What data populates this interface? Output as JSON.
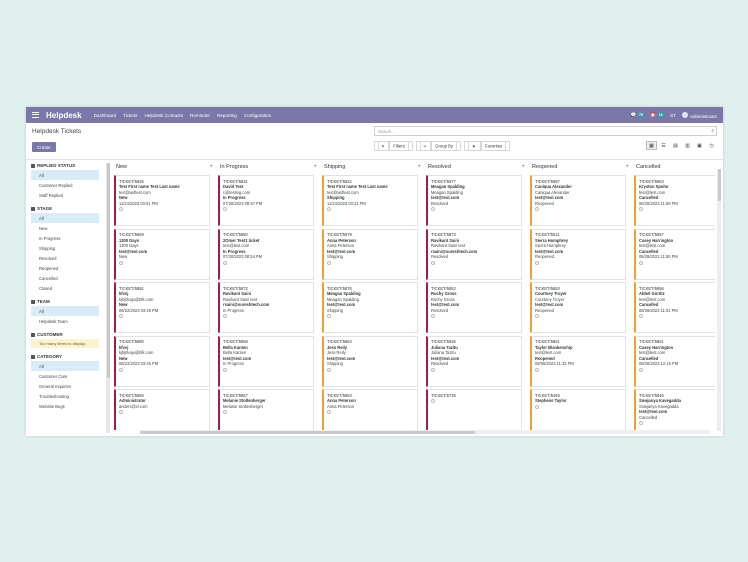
{
  "app": {
    "brand": "Helpdesk",
    "menu": [
      "Dashboard",
      "Tickets",
      "Helpdesk Contacts",
      "Reminder",
      "Reporting",
      "Configuration"
    ],
    "badge1": "79",
    "badge2": "19",
    "user_initials": "ST",
    "user_name": "Administrator"
  },
  "control": {
    "title": "Helpdesk Tickets",
    "create_label": "Create",
    "search_placeholder": "Search...",
    "filters_label": "Filters",
    "group_by_label": "Group By",
    "favorites_label": "Favorites"
  },
  "sidebar": {
    "replied": {
      "title": "REPLIED STATUS",
      "items": [
        "All",
        "Customer Replied",
        "Staff Replied"
      ]
    },
    "stage": {
      "title": "STAGE",
      "items": [
        "All",
        "New",
        "In Progress",
        "Shipping",
        "Resolved",
        "Reopened",
        "Cancelled",
        "Closed"
      ]
    },
    "team": {
      "title": "TEAM",
      "items": [
        "All",
        "Helpdesk Team"
      ]
    },
    "customer": {
      "title": "CUSTOMER",
      "note": "Too many items to display."
    },
    "category": {
      "title": "CATEGORY",
      "items": [
        "All",
        "Customer Care",
        "General Inquiries",
        "Troubleshooting",
        "Website Bugs"
      ]
    }
  },
  "columns": [
    {
      "name": "New",
      "color": "#a4194f",
      "cards": [
        {
          "id": "TICKET/5825",
          "name": "Test First name Test Last name",
          "email": "test@asftest.com",
          "stage": "New",
          "date": "11/24/2023 03:01 PM"
        },
        {
          "id": "TICKET/5869",
          "name": "1300 Days",
          "email": "1300 Days",
          "stage": "test@test.com",
          "date": "New"
        },
        {
          "id": "TICKET/5891",
          "name": "kfvvj",
          "email": "kjhjlrkaju@bfk.com",
          "stage": "New",
          "date": "08/22/2023 03:45 PM"
        },
        {
          "id": "TICKET/5890",
          "name": "kfvvj",
          "email": "kjhjlrkaju@bfk.com",
          "stage": "New",
          "date": "08/22/2023 03:45 PM"
        },
        {
          "id": "TICKET/5886",
          "name": "Administrator",
          "email": "anders@sl.com",
          "stage": "",
          "date": ""
        }
      ]
    },
    {
      "name": "In Progress",
      "color": "#a4194f",
      "cards": [
        {
          "id": "TICKET/5831",
          "name": "David Test",
          "email": "c@testing.com",
          "stage": "In Progress",
          "date": "07/28/2023 08:57 PM"
        },
        {
          "id": "TICKET/5880",
          "name": "2Omer Test1 ticket",
          "email": "test@test.com",
          "stage": "In Progress",
          "date": "07/20/2023 08:54 PM"
        },
        {
          "id": "TICKET/5872",
          "name": "Ravikant Saini",
          "email": "Ravikant Saini test",
          "stage": "rsaini@sureshtech.com",
          "date": "In Progress"
        },
        {
          "id": "TICKET/5868",
          "name": "Bella Kanten",
          "email": "Bella Kanten",
          "stage": "test@test.com",
          "date": "In Progress"
        },
        {
          "id": "TICKET/5867",
          "name": "Melanie Stoltenberger",
          "email": "Melanie Stoltenberger",
          "stage": "",
          "date": ""
        }
      ]
    },
    {
      "name": "Shipping",
      "color": "#f0a030",
      "cards": [
        {
          "id": "TICKET/5822",
          "name": "Test First name Test Last name",
          "email": "test@asftest.com",
          "stage": "Shipping",
          "date": "11/24/2023 03:22 PM"
        },
        {
          "id": "TICKET/5879",
          "name": "Anna Peterson",
          "email": "Anna Peterson",
          "stage": "test@test.com",
          "date": "Shipping"
        },
        {
          "id": "TICKET/5876",
          "name": "Meagan Spalding",
          "email": "Meagan Spalding",
          "stage": "test@test.com",
          "date": "Shipping"
        },
        {
          "id": "TICKET/5864",
          "name": "Jess Reily",
          "email": "Jess Reily",
          "stage": "test@test.com",
          "date": "Shipping"
        },
        {
          "id": "TICKET/5863",
          "name": "Anna Peterson",
          "email": "Anna Peterson",
          "stage": "",
          "date": ""
        }
      ]
    },
    {
      "name": "Resolved",
      "color": "#a4194f",
      "cards": [
        {
          "id": "TICKET/5877",
          "name": "Meagan Spalding",
          "email": "Meagan Spalding",
          "stage": "test@test.com",
          "date": "Resolved"
        },
        {
          "id": "TICKET/5873",
          "name": "Ravikant Saini",
          "email": "Ravikant Saini test",
          "stage": "rsaini@sureshtech.com",
          "date": "Resolved"
        },
        {
          "id": "TICKET/5852",
          "name": "Ruchy Gross",
          "email": "Ruchy Gross",
          "stage": "test@test.com",
          "date": "Resolved"
        },
        {
          "id": "TICKET/5836",
          "name": "Juliana Tazitu",
          "email": "Juliana Tazitu",
          "stage": "test@test.com",
          "date": "Resolved"
        },
        {
          "id": "TICKET/5735",
          "name": "",
          "email": "",
          "stage": "",
          "date": ""
        }
      ]
    },
    {
      "name": "Reopened",
      "color": "#f0a030",
      "cards": [
        {
          "id": "TICKET/5887",
          "name": "Caniqua Alexander",
          "email": "Caniqua Alexander",
          "stage": "test@test.com",
          "date": "Reopened"
        },
        {
          "id": "TICKET/5611",
          "name": "Sierra Humphrey",
          "email": "Sierra Humphrey",
          "stage": "test@test.com",
          "date": "Reopened"
        },
        {
          "id": "TICKET/5863",
          "name": "Courtney Troyer",
          "email": "Courtney Troyer",
          "stage": "test@test.com",
          "date": "Reopened"
        },
        {
          "id": "TICKET/5861",
          "name": "Taylor Blankenship",
          "email": "test@test.com",
          "stage": "Reopened",
          "date": "09/05/2023 11:33 PM"
        },
        {
          "id": "TICKET/5493",
          "name": "Stephens Taylor",
          "email": "",
          "stage": "",
          "date": ""
        }
      ]
    },
    {
      "name": "Cancelled",
      "color": "#f0a030",
      "cards": [
        {
          "id": "TICKET/5863",
          "name": "Kryston Spohn",
          "email": "test@test.com",
          "stage": "Cancelled",
          "date": "08/28/2023 11:59 PM"
        },
        {
          "id": "TICKET/5857",
          "name": "Casey Harrington",
          "email": "test@test.com",
          "stage": "Cancelled",
          "date": "08/28/2023 11:55 PM"
        },
        {
          "id": "TICKET/5856",
          "name": "Abbel Gortitz",
          "email": "test@test.com",
          "stage": "Cancelled",
          "date": "08/28/2023 11:51 PM"
        },
        {
          "id": "TICKET/5851",
          "name": "Casey Harrington",
          "email": "test@test.com",
          "stage": "Cancelled",
          "date": "08/28/2023 12:15 PM"
        },
        {
          "id": "TICKET/5846",
          "name": "Sowjanya Kavegadda",
          "email": "Sowjanya Kavegadda",
          "stage": "test@test.com",
          "date": "Cancelled"
        }
      ]
    }
  ]
}
